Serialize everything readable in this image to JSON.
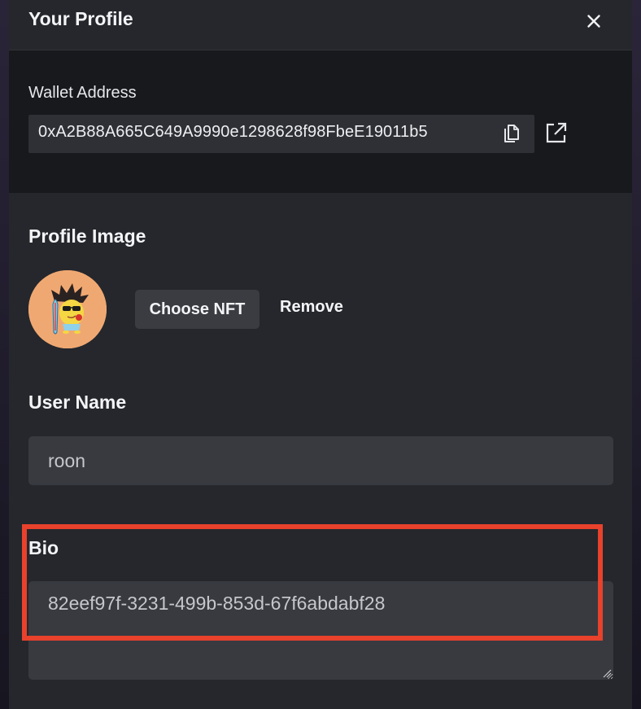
{
  "modal": {
    "title": "Your Profile"
  },
  "wallet": {
    "label": "Wallet Address",
    "address": "0xA2B88A665C649A9990e1298628f98FbeE19011b5"
  },
  "profile_image": {
    "title": "Profile Image",
    "choose_label": "Choose NFT",
    "remove_label": "Remove"
  },
  "username": {
    "label": "User Name",
    "value": "roon"
  },
  "bio": {
    "label": "Bio",
    "value": "82eef97f-3231-499b-853d-67f6abdabf28"
  },
  "icons": {
    "close": "close-icon",
    "copy": "copy-icon",
    "external": "external-link-icon"
  },
  "colors": {
    "highlight": "#e8412c",
    "avatar_bg": "#f0a872"
  }
}
